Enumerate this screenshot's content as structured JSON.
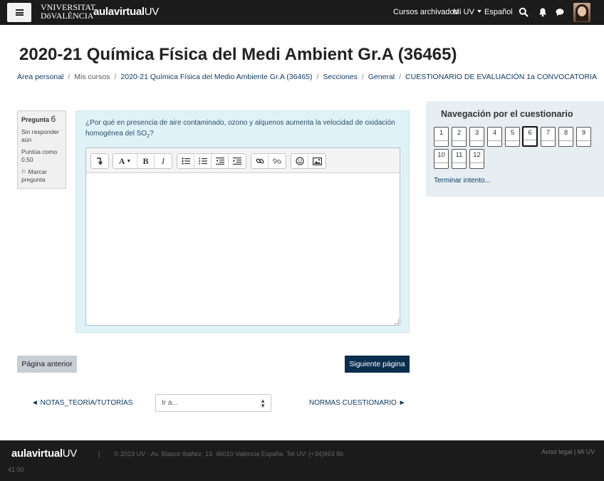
{
  "navbar": {
    "uv_logo_line1": "VNIVERSITAT",
    "uv_logo_line2": "DöVALÈNCIA",
    "aulavirtual_main": "aulavirtual",
    "aulavirtual_suffix": "UV",
    "links": {
      "archived": "Cursos archivados",
      "mi_uv": "Mi UV",
      "language": "Español"
    },
    "icons": [
      "search-icon",
      "bell-icon",
      "chat-icon"
    ]
  },
  "page": {
    "title": "2020-21 Química Física del Medi Ambient Gr.A (36465)"
  },
  "breadcrumb": [
    "Área personal",
    "Mis cursos",
    "2020-21 Química Física del Medio Ambiente Gr.A (36465)",
    "Secciones",
    "General",
    "CUESTIONARIO DE EVALUACIÓN 1a CONVOCATORIA"
  ],
  "question": {
    "label": "Pregunta",
    "number": "6",
    "status": "Sin responder aún",
    "score_label": "Puntúa como 0,50",
    "flag_label": "Marcar pregunta",
    "text_before": "¿Por qué en presencia de aire contaminado, ozono y alquenos aumenta la velocidad de oxidación homogénea del SO",
    "text_sub": "2",
    "text_after": "?",
    "answer": ""
  },
  "quiz_nav": {
    "title": "Navegación por el cuestionario",
    "buttons": [
      "1",
      "2",
      "3",
      "4",
      "5",
      "6",
      "7",
      "8",
      "9",
      "10",
      "11",
      "12"
    ],
    "current": "6",
    "finish_label": "Terminar intento..."
  },
  "buttons": {
    "prev_page": "Página anterior",
    "next_page": "Siguiente página"
  },
  "activity_nav": {
    "prev": "◄ NOTAS_TEORÍA/TUTORÍAS",
    "jump_placeholder": "Ir a...",
    "next": "NORMAS CUESTIONARIO ►"
  },
  "footer": {
    "logo_main": "aulavirtual",
    "logo_suffix": "UV",
    "separator": "|",
    "address": "© 2019 UV - Av. Blasco Ibáñez, 13. 46010 València España. Tel UV: (+34)963 86",
    "address2": "41 00",
    "links": "Aviso legal | Mi UV"
  },
  "colors": {
    "navbar_bg": "#1b1b1b",
    "question_bg": "#def2f8",
    "primary_button": "#0c2e4e",
    "link": "#0f3a63"
  }
}
